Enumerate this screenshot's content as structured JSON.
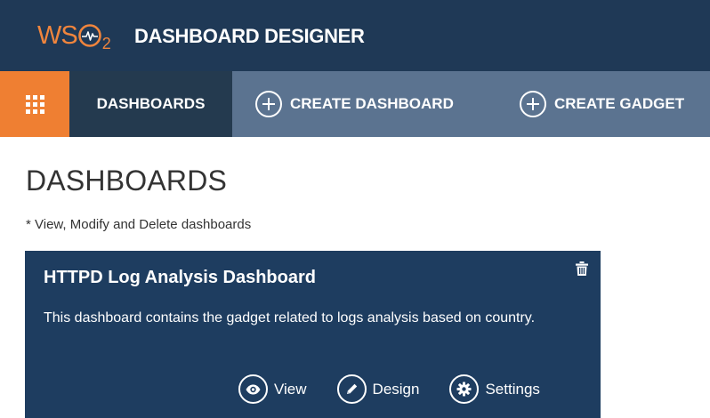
{
  "header": {
    "logo_text": "WSO2",
    "logo_ws": "WS",
    "logo_sub": "2",
    "title": "DASHBOARD DESIGNER"
  },
  "nav": {
    "menu_icon": "grid-icon",
    "items": [
      {
        "label": "DASHBOARDS",
        "active": true
      },
      {
        "label": "CREATE DASHBOARD",
        "icon": "plus-circle-icon"
      },
      {
        "label": "CREATE GADGET",
        "icon": "plus-circle-icon"
      }
    ]
  },
  "page": {
    "title": "DASHBOARDS",
    "subtitle": "* View, Modify and Delete dashboards"
  },
  "dashboards": [
    {
      "title": "HTTPD Log Analysis Dashboard",
      "description": "This dashboard contains the gadget related to logs analysis based on country.",
      "delete_icon": "trash-icon",
      "actions": [
        {
          "label": "View",
          "icon": "eye-icon"
        },
        {
          "label": "Design",
          "icon": "pencil-icon"
        },
        {
          "label": "Settings",
          "icon": "gear-icon"
        }
      ]
    }
  ],
  "colors": {
    "header_bg": "#1f3956",
    "nav_bg": "#5b7390",
    "nav_active_bg": "#243a4f",
    "accent_orange": "#ef7f32",
    "card_bg": "#1e3d60"
  }
}
